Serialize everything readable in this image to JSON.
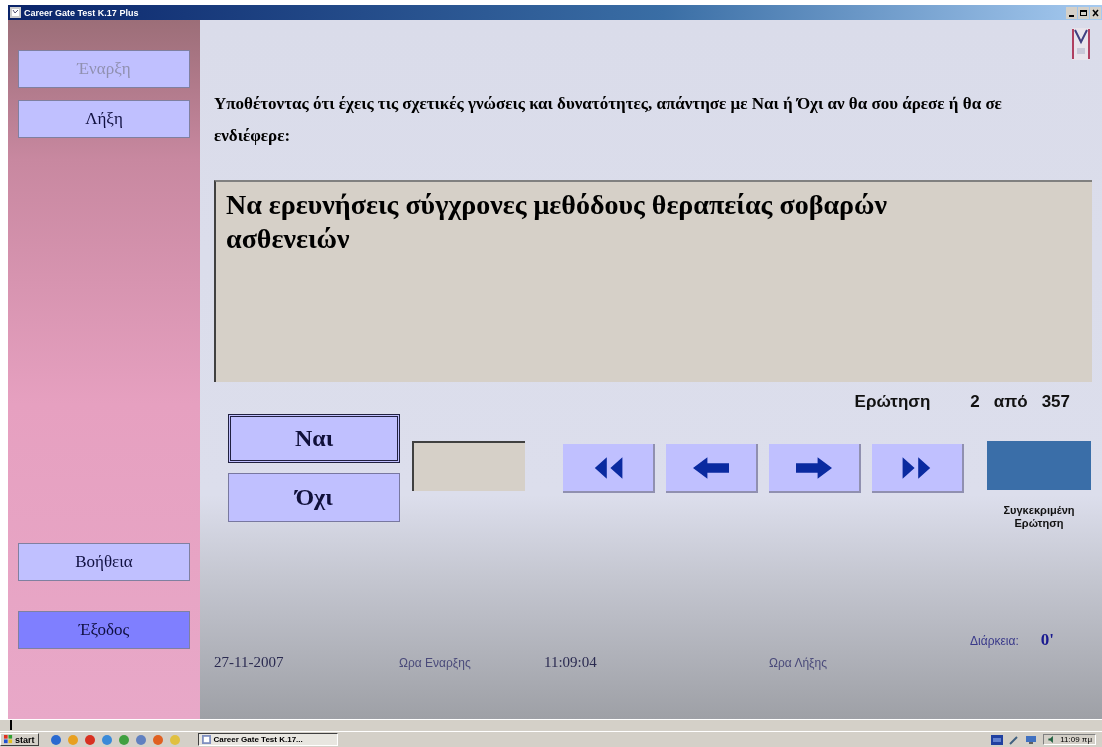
{
  "window": {
    "title": "Career Gate Test K.17 Plus"
  },
  "sidebar": {
    "top_buttons": [
      {
        "label": "Έναρξη",
        "disabled": true,
        "highlighted": false
      },
      {
        "label": "Λήξη",
        "disabled": false,
        "highlighted": false
      }
    ],
    "bottom_buttons": [
      {
        "label": "Βοήθεια",
        "disabled": false,
        "highlighted": false
      },
      {
        "label": "Έξοδος",
        "disabled": false,
        "highlighted": true
      }
    ]
  },
  "question": {
    "prompt": "Υποθέτοντας ότι έχεις τις σχετικές γνώσεις και δυνατότητες, απάντησε με Ναι ή Όχι αν θα σου άρεσε ή θα σε ενδιέφερε:",
    "text": "Να ερευνήσεις σύγχρονες μεθόδους θεραπείας σοβαρών ασθενειών"
  },
  "counter": {
    "label": "Ερώτηση",
    "current": "2",
    "of": "από",
    "total": "357"
  },
  "answers": [
    {
      "label": "Ναι",
      "focused": true
    },
    {
      "label": "Όχι",
      "focused": false
    }
  ],
  "navigation": [
    {
      "kind": "first"
    },
    {
      "kind": "previous"
    },
    {
      "kind": "next"
    },
    {
      "kind": "last"
    }
  ],
  "goto": {
    "label": "Συγκεκριμένη Ερώτηση"
  },
  "footer": {
    "date": "27-11-2007",
    "start_label": "Ωρα Εναρξης",
    "start_time": "11:09:04",
    "end_label": "Ωρα Λήξης",
    "duration_label": "Διάρκεια:",
    "duration": "0'"
  },
  "taskbar": {
    "start": "start",
    "task": "Career Gate Test K.17...",
    "clock": "11:09 πμ"
  }
}
